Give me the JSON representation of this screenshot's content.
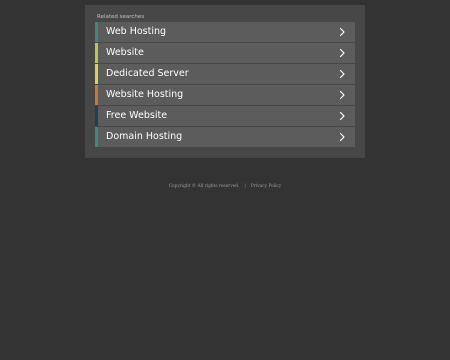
{
  "related": {
    "title": "Related searches",
    "items": [
      {
        "label": "Web Hosting",
        "accent": "#3d8a7a"
      },
      {
        "label": "Website",
        "accent": "#b9c944"
      },
      {
        "label": "Dedicated Server",
        "accent": "#d8d34b"
      },
      {
        "label": "Website Hosting",
        "accent": "#c8782f"
      },
      {
        "label": "Free Website",
        "accent": "#1f3f56"
      },
      {
        "label": "Domain Hosting",
        "accent": "#3d8a7a"
      }
    ],
    "chevron_icon": "chevron-right-icon"
  },
  "footer": {
    "copyright": "Copyright ©  All rights reserved.",
    "separator": "|",
    "privacy": "Privacy Policy"
  },
  "colors": {
    "background": "#333333",
    "panel": "#474747",
    "row": "#5c5c5c"
  }
}
